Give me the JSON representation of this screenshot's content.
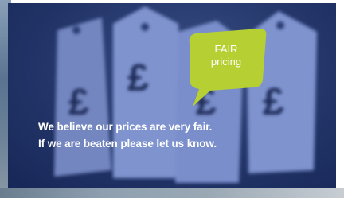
{
  "bubble": {
    "line1": "FAIR",
    "line2": "pricing",
    "color": "#b6cf32"
  },
  "caption": {
    "line1": "We believe our prices are very fair.",
    "line2": "If we are beaten please let us know."
  },
  "tags": {
    "symbol": "£",
    "color": "#7f93cf",
    "background": "#233569"
  }
}
